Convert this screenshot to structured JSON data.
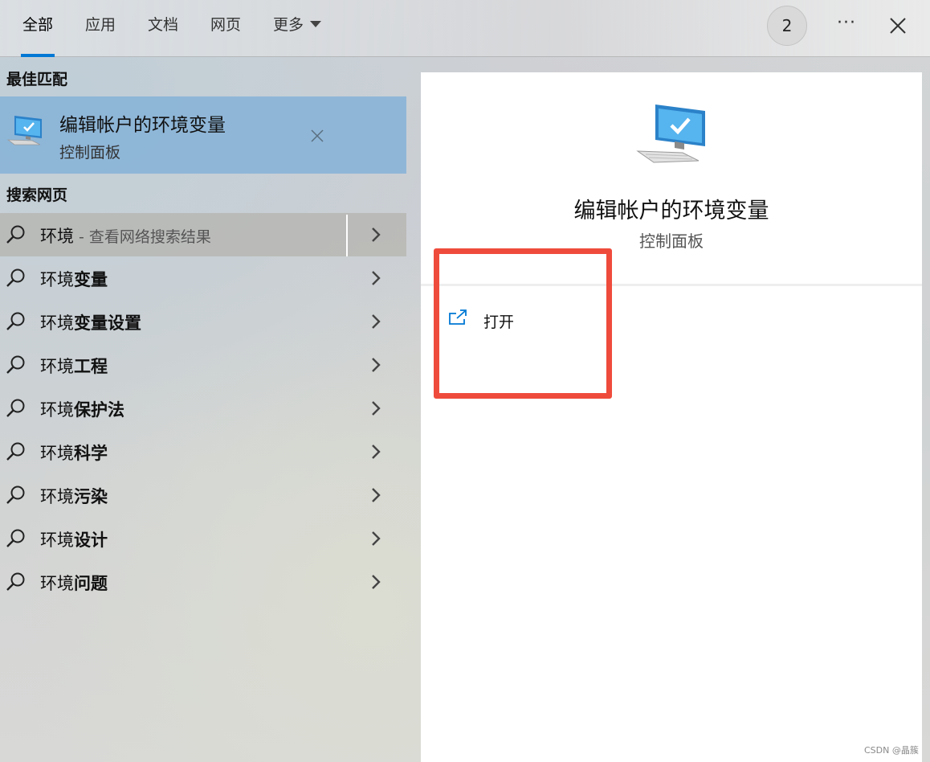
{
  "tabs": [
    {
      "label": "全部"
    },
    {
      "label": "应用"
    },
    {
      "label": "文档"
    },
    {
      "label": "网页"
    },
    {
      "label": "更多"
    }
  ],
  "header": {
    "badge_count": "2",
    "more_label": "···"
  },
  "best_match": {
    "section_title": "最佳匹配",
    "title": "编辑帐户的环境变量",
    "subtitle": "控制面板"
  },
  "web_search": {
    "section_title": "搜索网页",
    "results": [
      {
        "prefix": "环境",
        "bold": "",
        "hint": " - 查看网络搜索结果"
      },
      {
        "prefix": "环境",
        "bold": "变量",
        "hint": ""
      },
      {
        "prefix": "环境",
        "bold": "变量设置",
        "hint": ""
      },
      {
        "prefix": "环境",
        "bold": "工程",
        "hint": ""
      },
      {
        "prefix": "环境",
        "bold": "保护法",
        "hint": ""
      },
      {
        "prefix": "环境",
        "bold": "科学",
        "hint": ""
      },
      {
        "prefix": "环境",
        "bold": "污染",
        "hint": ""
      },
      {
        "prefix": "环境",
        "bold": "设计",
        "hint": ""
      },
      {
        "prefix": "环境",
        "bold": "问题",
        "hint": ""
      }
    ]
  },
  "detail": {
    "title": "编辑帐户的环境变量",
    "subtitle": "控制面板",
    "actions": [
      {
        "label": "打开"
      }
    ]
  },
  "watermark": "CSDN @晶簇",
  "colors": {
    "accent": "#0078d4",
    "highlight_box": "#ef4b3c",
    "best_match_bg": "#8ab4d7"
  }
}
